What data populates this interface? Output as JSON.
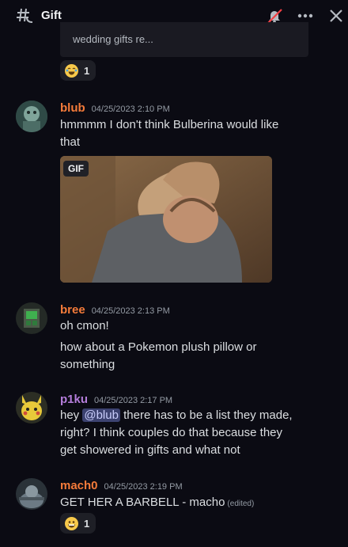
{
  "header": {
    "title": "Gift",
    "thread_icon": "thread-icon",
    "mute_icon": "bell-slash-icon",
    "more_icon": "ellipsis-icon",
    "close_icon": "close-icon"
  },
  "previous": {
    "embed_text": "wedding gifts re...",
    "reaction": {
      "emoji": "joy",
      "count": "1"
    }
  },
  "messages": [
    {
      "username": "blub",
      "username_color": "#f47b3a",
      "timestamp": "04/25/2023 2:10 PM",
      "lines": [
        "hmmmm I don't think Bulberina would like",
        "that"
      ],
      "attachment": {
        "type": "gif",
        "badge": "GIF"
      }
    },
    {
      "username": "bree",
      "username_color": "#f47b3a",
      "timestamp": "04/25/2023 2:13 PM",
      "lines": [
        "oh cmon!"
      ],
      "followup": [
        "how about a Pokemon plush pillow or",
        "something"
      ]
    },
    {
      "username": "p1ku",
      "username_color": "#b57edc",
      "timestamp": "04/25/2023 2:17 PM",
      "line1_pre": "hey",
      "mention": "@blub",
      "line1_post": "there has to be a list they made,",
      "lines": [
        "right? I think couples do that because they",
        "get showered in gifts and what not"
      ]
    },
    {
      "username": "mach0",
      "username_color": "#f47b3a",
      "timestamp": "04/25/2023 2:19 PM",
      "text": "GET HER A BARBELL - macho",
      "edited": "(edited)",
      "reaction": {
        "emoji": "grin",
        "count": "1"
      }
    }
  ]
}
